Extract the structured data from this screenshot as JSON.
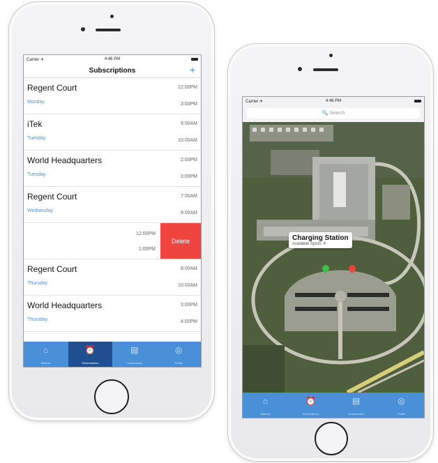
{
  "subscriptions_screen": {
    "status": {
      "carrier": "Carrier ✈",
      "time": "4:46 PM"
    },
    "title": "Subscriptions",
    "add_icon": "+",
    "rows": [
      {
        "title": "Regent Court",
        "day": "Monday",
        "start": "12:00PM",
        "end": "3:00PM"
      },
      {
        "title": "iTek",
        "day": "Tuesday",
        "start": "9:00AM",
        "end": "10:00AM"
      },
      {
        "title": "World Headquarters",
        "day": "Tuesday",
        "start": "2:00PM",
        "end": "3:00PM"
      },
      {
        "title": "Regent Court",
        "day": "Wednesday",
        "start": "7:00AM",
        "end": "9:00AM"
      },
      {
        "title": "",
        "day": "",
        "start": "12:00PM",
        "end": "1:00PM",
        "delete": "Delete"
      },
      {
        "title": "Regent Court",
        "day": "Thursday",
        "start": "8:00AM",
        "end": "10:00AM"
      },
      {
        "title": "World Headquarters",
        "day": "Thursday",
        "start": "3:00PM",
        "end": "4:00PM"
      }
    ],
    "tabs": [
      {
        "label": "Stations",
        "icon": "home-icon"
      },
      {
        "label": "Subscriptions",
        "icon": "alarm-clock-icon"
      },
      {
        "label": "Leaderboard",
        "icon": "list-icon"
      },
      {
        "label": "Profile",
        "icon": "profile-icon"
      }
    ]
  },
  "map_screen": {
    "status": {
      "carrier": "Carrier ✈",
      "time": "4:46 PM"
    },
    "search_placeholder": "🔍 Search",
    "callout": {
      "title": "Charging Station",
      "subtitle": "Available Spots: 4"
    },
    "pin_colors": {
      "available": "#3fbf4a",
      "unavailable": "#e8453c"
    },
    "tabs": [
      {
        "label": "Stations",
        "icon": "home-icon"
      },
      {
        "label": "Subscriptions",
        "icon": "alarm-clock-icon"
      },
      {
        "label": "Leaderboard",
        "icon": "list-icon"
      },
      {
        "label": "Profile",
        "icon": "profile-icon"
      }
    ]
  }
}
